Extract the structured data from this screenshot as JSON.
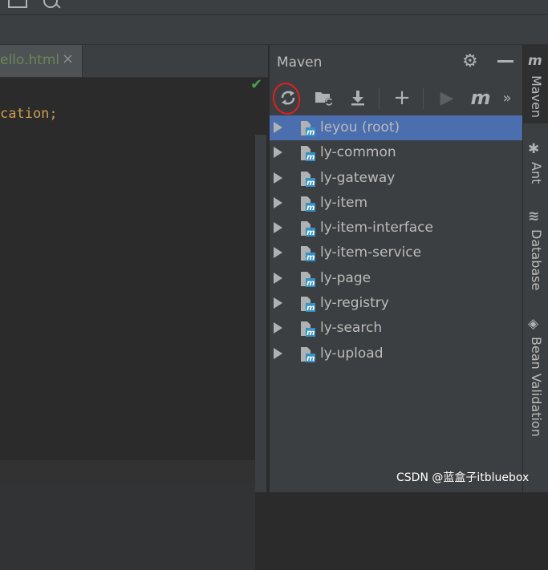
{
  "editor": {
    "tab_name": "ello.html",
    "tab_close": "×",
    "code_line": "cation;"
  },
  "maven": {
    "title": "Maven",
    "toolbar": {
      "reload": "reload-icon",
      "generate_sources": "folder-reload-icon",
      "download": "download-icon",
      "add": "+",
      "run": "▶",
      "execute_goal": "m",
      "more": "»"
    },
    "projects": [
      {
        "label": "leyou (root)",
        "selected": true
      },
      {
        "label": "ly-common",
        "selected": false
      },
      {
        "label": "ly-gateway",
        "selected": false
      },
      {
        "label": "ly-item",
        "selected": false
      },
      {
        "label": "ly-item-interface",
        "selected": false
      },
      {
        "label": "ly-item-service",
        "selected": false
      },
      {
        "label": "ly-page",
        "selected": false
      },
      {
        "label": "ly-registry",
        "selected": false
      },
      {
        "label": "ly-search",
        "selected": false
      },
      {
        "label": "ly-upload",
        "selected": false
      }
    ]
  },
  "rail": {
    "maven": "Maven",
    "ant": "Ant",
    "database": "Database",
    "bean_validation": "Bean Validation"
  },
  "watermark": "CSDN @蓝盒子itbluebox",
  "colors": {
    "selection": "#4b6eaf",
    "panel_bg": "#3c3f41",
    "editor_bg": "#2b2b2b",
    "maven_blue": "#3592c4"
  }
}
